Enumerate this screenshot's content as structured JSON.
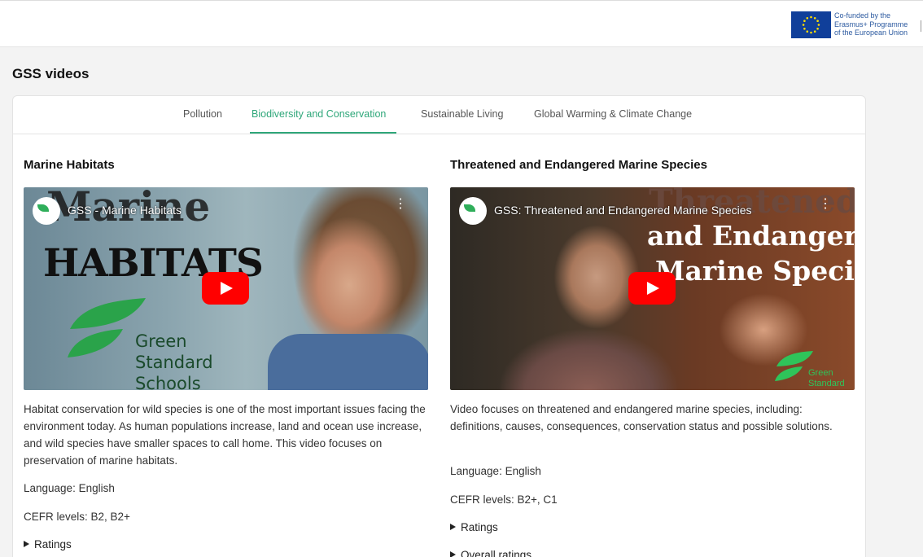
{
  "header": {
    "eu_text_lines": [
      "Co-funded by the",
      "Erasmus+ Programme",
      "of the European Union"
    ]
  },
  "page": {
    "title": "GSS videos"
  },
  "tabs": [
    {
      "label": "Pollution",
      "active": false
    },
    {
      "label": "Biodiversity and Conservation",
      "active": true
    },
    {
      "label": "Sustainable Living",
      "active": false
    },
    {
      "label": "Global Warming & Climate Change",
      "active": false
    }
  ],
  "videos": [
    {
      "heading": "Marine Habitats",
      "player_title": "GSS - Marine Habitats",
      "thumbnail_text": {
        "line1": "Marine",
        "line2": "HABITATS",
        "brand": [
          "Green",
          "Standard",
          "Schools"
        ]
      },
      "description": "Habitat conservation for wild species is one of the most important issues facing the environment today. As human populations increase, land and ocean use increase, and wild species have smaller spaces to call home. This video focuses on preservation of marine habitats.",
      "language": "Language: English",
      "cefr": "CEFR levels: B2, B2+",
      "ratings_label": "Ratings"
    },
    {
      "heading": "Threatened and Endangered Marine Species",
      "player_title": "GSS: Threatened and Endangered Marine Species",
      "thumbnail_text": {
        "line1": "Threatened",
        "line2": "and Endangered",
        "line3": "Marine Species",
        "brand": [
          "Green",
          "Standard"
        ]
      },
      "description": "Video focuses on threatened and endangered marine species, including: definitions, causes, consequences, conservation status and possible solutions.",
      "language": "Language: English",
      "cefr": "CEFR levels: B2+, C1",
      "ratings_label": "Ratings",
      "overall_ratings_label": "Overall ratings"
    }
  ],
  "colors": {
    "accent": "#2fa77a",
    "youtube_red": "#ff0000",
    "eu_blue": "#103f9a"
  }
}
